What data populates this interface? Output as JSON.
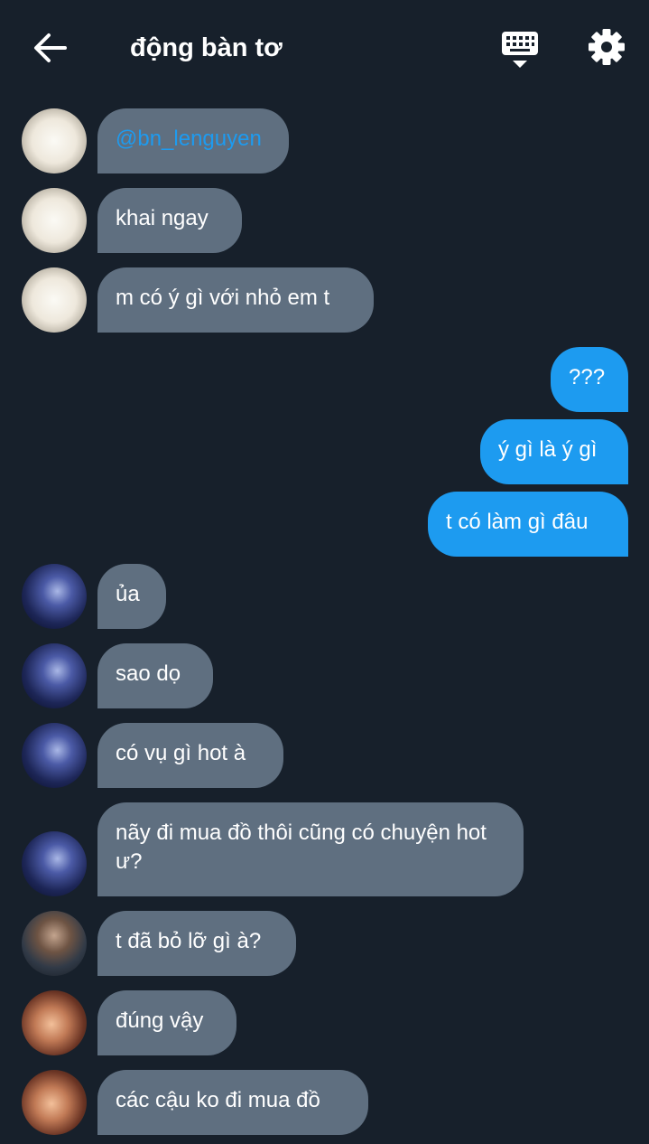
{
  "header": {
    "title": "động bàn tơ",
    "back_icon": "arrow-left-icon",
    "keyboard_icon": "keyboard-icon",
    "settings_icon": "gear-icon"
  },
  "colors": {
    "background": "#17202b",
    "incoming_bubble": "#5f6f80",
    "outgoing_bubble": "#1d9bf0",
    "mention": "#1d9bf0"
  },
  "messages": [
    {
      "side": "incoming",
      "text": "@bn_lenguyen"
    },
    {
      "side": "incoming",
      "text": "khai ngay"
    },
    {
      "side": "incoming",
      "text": "m có ý gì với nhỏ em t"
    },
    {
      "side": "outgoing",
      "text": "???"
    },
    {
      "side": "outgoing",
      "text": "ý gì là ý gì"
    },
    {
      "side": "outgoing",
      "text": "t có làm gì đâu"
    },
    {
      "side": "incoming",
      "text": "ủa"
    },
    {
      "side": "incoming",
      "text": "sao dọ"
    },
    {
      "side": "incoming",
      "text": "có vụ gì hot à"
    },
    {
      "side": "incoming",
      "text": "nãy đi mua đồ thôi cũng có chuyện hot ư?"
    },
    {
      "side": "incoming",
      "text": "t đã bỏ lỡ gì à?"
    },
    {
      "side": "incoming",
      "text": "đúng vậy"
    },
    {
      "side": "incoming",
      "text": "các cậu ko đi mua đồ"
    }
  ]
}
